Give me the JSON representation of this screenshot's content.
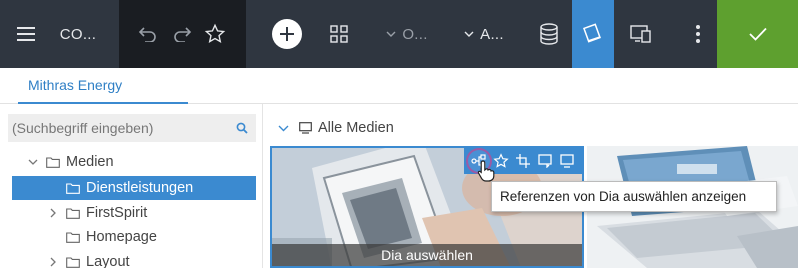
{
  "toolbar": {
    "menu_icon": "hamburger-menu-icon",
    "project_short": "CO...",
    "undo_icon": "undo-icon",
    "redo_icon": "redo-icon",
    "favorite_icon": "star-icon",
    "add_icon": "plus-circle-icon",
    "apps_icon": "grid-apps-icon",
    "dropdown1_label": "O...",
    "dropdown2_label": "A...",
    "stack_icon": "database-stack-icon",
    "media_icon": "media-mode-icon",
    "preview_icon": "device-preview-icon",
    "more_icon": "more-vertical-icon",
    "save_icon": "checkmark-icon",
    "accent": "#3b8ad0",
    "save_color": "#5ea02f"
  },
  "project_tab": {
    "label": "Mithras Energy"
  },
  "search": {
    "placeholder": "(Suchbegriff eingeben)"
  },
  "tree": {
    "items": [
      {
        "label": "Medien",
        "expanded": true,
        "selected": false
      },
      {
        "label": "Dienstleistungen",
        "expanded": false,
        "selected": true
      },
      {
        "label": "FirstSpirit",
        "expanded": false,
        "selected": false
      },
      {
        "label": "Homepage",
        "expanded": false,
        "selected": false
      },
      {
        "label": "Layout",
        "expanded": false,
        "selected": false
      }
    ]
  },
  "breadcrumb": {
    "label": "Alle Medien"
  },
  "tiles": [
    {
      "caption": "Dia auswählen",
      "selected": true
    },
    {
      "caption": "",
      "selected": false
    }
  ],
  "tile_actions": [
    "references-icon",
    "star-icon",
    "crop-icon",
    "preview-icon",
    "monitor-icon"
  ],
  "tooltip": {
    "text": "Referenzen von Dia auswählen anzeigen"
  }
}
